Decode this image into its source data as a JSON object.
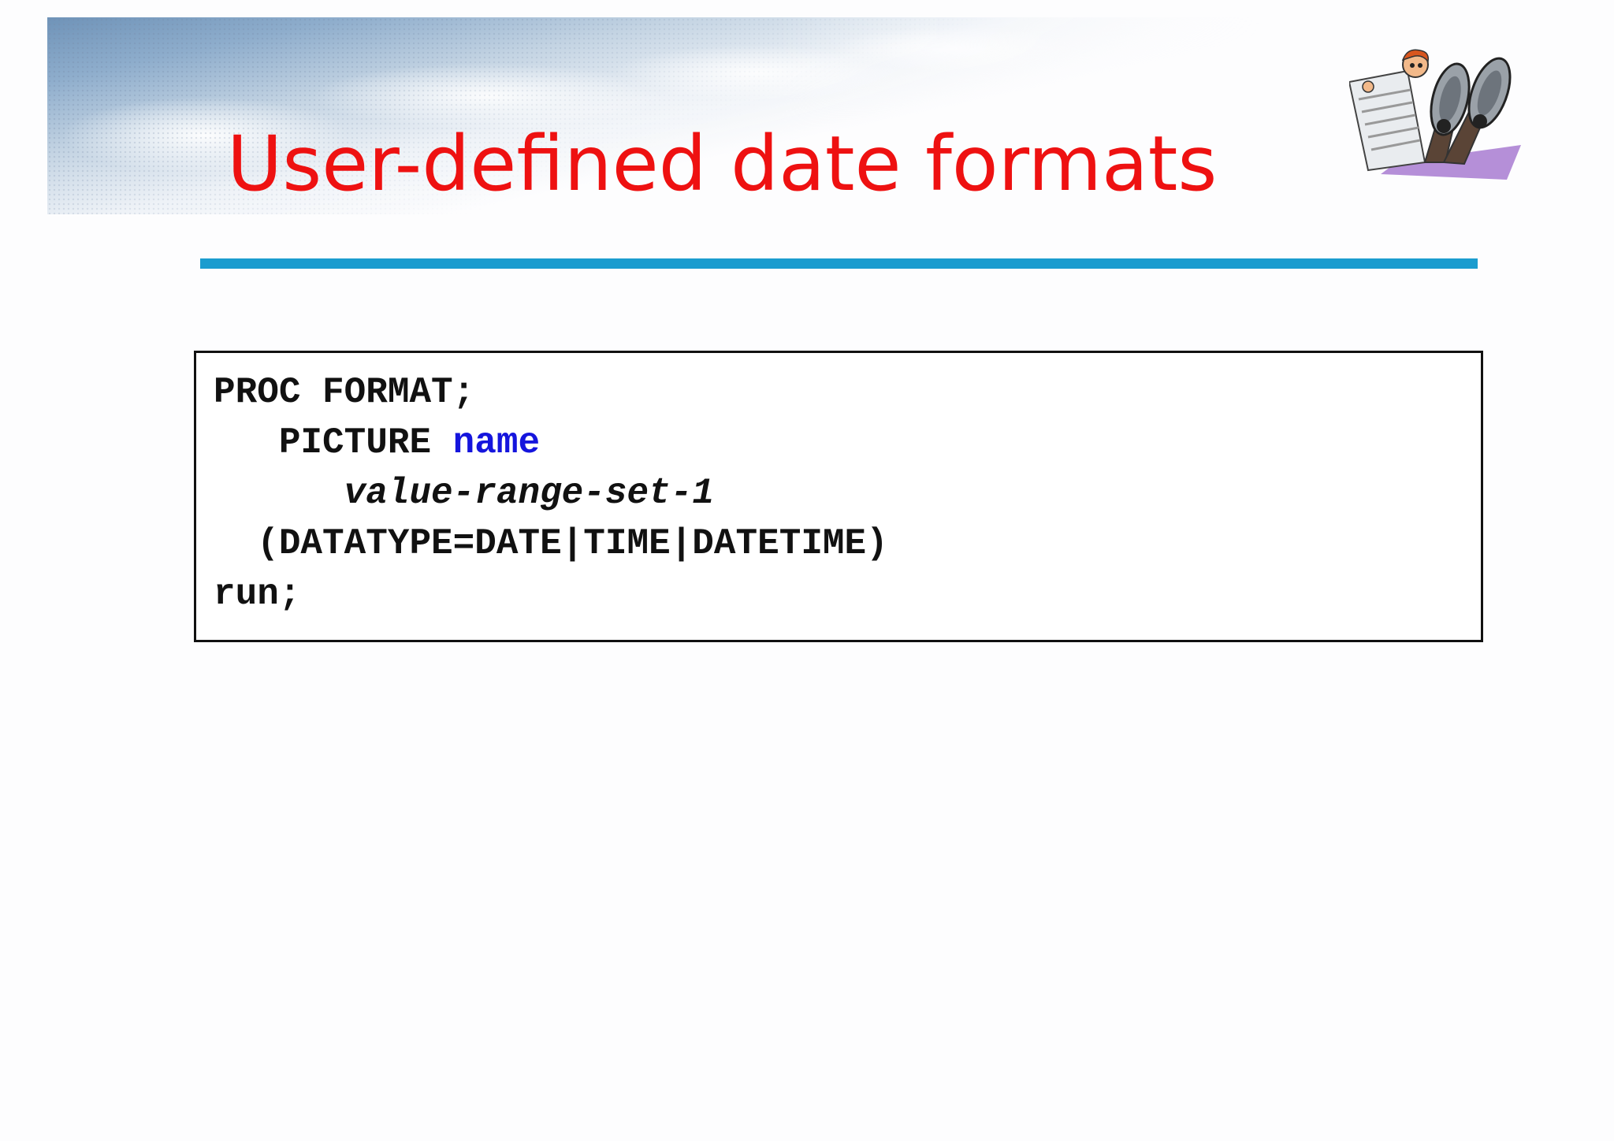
{
  "slide": {
    "title": "User-defined date formats",
    "accent_color": "#1a9ccf",
    "title_color": "#ee1111",
    "clipart_icon": "man-reading-newspaper-icon"
  },
  "code": {
    "line1": "PROC FORMAT;",
    "line2_indent": "   ",
    "line2_keyword": "PICTURE ",
    "line2_name": "name",
    "line3_indent": "      ",
    "line3_text": "value-range-set-1",
    "line4_indent": "  ",
    "line4_text": "(DATATYPE=DATE|TIME|DATETIME)",
    "line5": "run;",
    "name_color": "#1515dd"
  }
}
